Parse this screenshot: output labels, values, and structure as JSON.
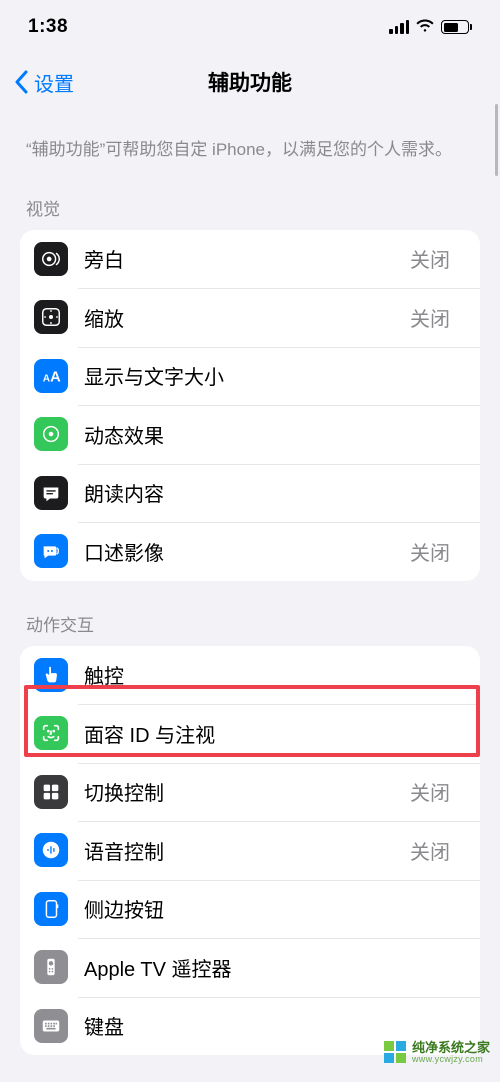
{
  "status": {
    "time": "1:38"
  },
  "nav": {
    "back": "设置",
    "title": "辅助功能"
  },
  "intro": "“辅助功能”可帮助您自定 iPhone，以满足您的个人需求。",
  "sections": {
    "visual": {
      "header": "视觉",
      "items": [
        {
          "label": "旁白",
          "status": "关闭"
        },
        {
          "label": "缩放",
          "status": "关闭"
        },
        {
          "label": "显示与文字大小",
          "status": ""
        },
        {
          "label": "动态效果",
          "status": ""
        },
        {
          "label": "朗读内容",
          "status": ""
        },
        {
          "label": "口述影像",
          "status": "关闭"
        }
      ]
    },
    "motor": {
      "header": "动作交互",
      "items": [
        {
          "label": "触控",
          "status": ""
        },
        {
          "label": "面容 ID 与注视",
          "status": ""
        },
        {
          "label": "切换控制",
          "status": "关闭"
        },
        {
          "label": "语音控制",
          "status": "关闭"
        },
        {
          "label": "侧边按钮",
          "status": ""
        },
        {
          "label": "Apple TV 遥控器",
          "status": ""
        },
        {
          "label": "键盘",
          "status": ""
        }
      ]
    }
  },
  "watermark": {
    "line1": "纯净系统之家",
    "line2": "www.ycwjzy.com"
  }
}
